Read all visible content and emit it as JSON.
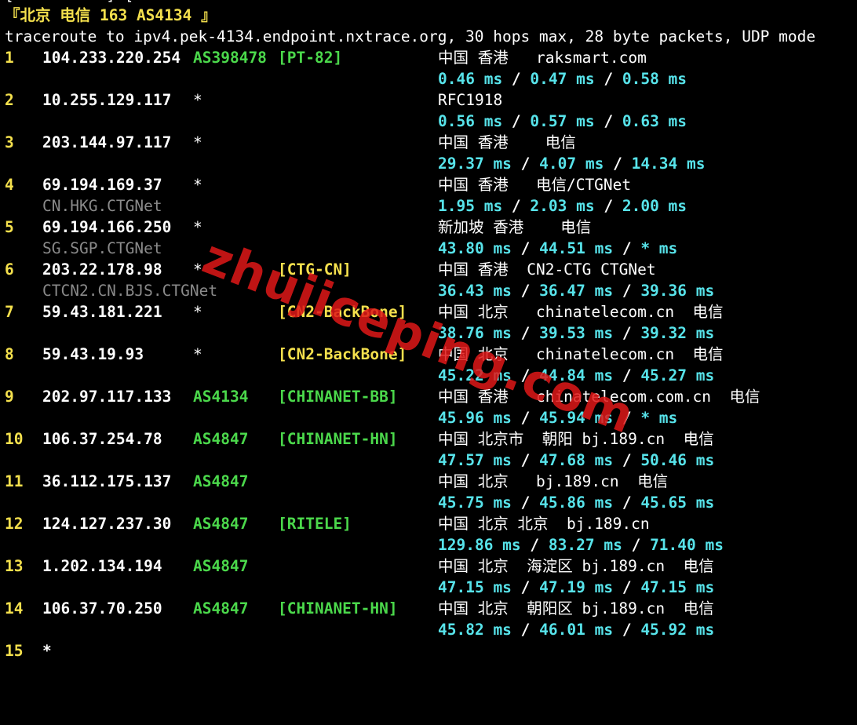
{
  "top_cut": "[          ] [",
  "header": {
    "title": "『北京 电信 163 AS4134 』",
    "command": "traceroute to ipv4.pek-4134.endpoint.nxtrace.org, 30 hops max, 28 byte packets, UDP mode"
  },
  "hops": [
    {
      "n": "1",
      "ip": "104.233.220.254",
      "asn": "AS398478",
      "tag": "[PT-82]",
      "tagColor": "green",
      "loc": "中国 香港   raksmart.com",
      "rdns": "",
      "rtt": [
        "0.46 ms",
        "0.47 ms",
        "0.58 ms"
      ]
    },
    {
      "n": "2",
      "ip": "10.255.129.117",
      "asn": "*",
      "tag": "",
      "tagColor": "",
      "loc": "RFC1918",
      "rdns": "",
      "rtt": [
        "0.56 ms",
        "0.57 ms",
        "0.63 ms"
      ]
    },
    {
      "n": "3",
      "ip": "203.144.97.117",
      "asn": "*",
      "tag": "",
      "tagColor": "",
      "loc": "中国 香港    电信",
      "rdns": "",
      "rtt": [
        "29.37 ms",
        "4.07 ms",
        "14.34 ms"
      ]
    },
    {
      "n": "4",
      "ip": "69.194.169.37",
      "asn": "*",
      "tag": "",
      "tagColor": "",
      "loc": "中国 香港   电信/CTGNet",
      "rdns": "CN.HKG.CTGNet",
      "rtt": [
        "1.95 ms",
        "2.03 ms",
        "2.00 ms"
      ]
    },
    {
      "n": "5",
      "ip": "69.194.166.250",
      "asn": "*",
      "tag": "",
      "tagColor": "",
      "loc": "新加坡 香港    电信",
      "rdns": "SG.SGP.CTGNet",
      "rtt": [
        "43.80 ms",
        "44.51 ms",
        "* ms"
      ]
    },
    {
      "n": "6",
      "ip": "203.22.178.98",
      "asn": "*",
      "tag": "[CTG-CN]",
      "tagColor": "yellow",
      "loc": "中国 香港  CN2-CTG CTGNet",
      "rdns": "CTCN2.CN.BJS.CTGNet",
      "rtt": [
        "36.43 ms",
        "36.47 ms",
        "39.36 ms"
      ]
    },
    {
      "n": "7",
      "ip": "59.43.181.221",
      "asn": "*",
      "tag": "[CN2-BackBone]",
      "tagColor": "yellow",
      "loc": "中国 北京   chinatelecom.cn  电信",
      "rdns": "",
      "rtt": [
        "38.76 ms",
        "39.53 ms",
        "39.32 ms"
      ]
    },
    {
      "n": "8",
      "ip": "59.43.19.93",
      "asn": "*",
      "tag": "[CN2-BackBone]",
      "tagColor": "yellow",
      "loc": "中国 北京   chinatelecom.cn  电信",
      "rdns": "",
      "rtt": [
        "45.22 ms",
        "44.84 ms",
        "45.27 ms"
      ]
    },
    {
      "n": "9",
      "ip": "202.97.117.133",
      "asn": "AS4134",
      "tag": "[CHINANET-BB]",
      "tagColor": "green",
      "loc": "中国 香港   chinatelecom.com.cn  电信",
      "rdns": "",
      "rtt": [
        "45.96 ms",
        "45.94 ms",
        "* ms"
      ]
    },
    {
      "n": "10",
      "ip": "106.37.254.78",
      "asn": "AS4847",
      "tag": "[CHINANET-HN]",
      "tagColor": "green",
      "loc": "中国 北京市  朝阳 bj.189.cn  电信",
      "rdns": "",
      "rtt": [
        "47.57 ms",
        "47.68 ms",
        "50.46 ms"
      ]
    },
    {
      "n": "11",
      "ip": "36.112.175.137",
      "asn": "AS4847",
      "tag": "",
      "tagColor": "",
      "loc": "中国 北京   bj.189.cn  电信",
      "rdns": "",
      "rtt": [
        "45.75 ms",
        "45.86 ms",
        "45.65 ms"
      ]
    },
    {
      "n": "12",
      "ip": "124.127.237.30",
      "asn": "AS4847",
      "tag": "[RITELE]",
      "tagColor": "green",
      "loc": "中国 北京 北京  bj.189.cn",
      "rdns": "",
      "rtt": [
        "129.86 ms",
        "83.27 ms",
        "71.40 ms"
      ]
    },
    {
      "n": "13",
      "ip": "1.202.134.194",
      "asn": "AS4847",
      "tag": "",
      "tagColor": "",
      "loc": "中国 北京  海淀区 bj.189.cn  电信",
      "rdns": "",
      "rtt": [
        "47.15 ms",
        "47.19 ms",
        "47.15 ms"
      ]
    },
    {
      "n": "14",
      "ip": "106.37.70.250",
      "asn": "AS4847",
      "tag": "[CHINANET-HN]",
      "tagColor": "green",
      "loc": "中国 北京  朝阳区 bj.189.cn  电信",
      "rdns": "",
      "rtt": [
        "45.82 ms",
        "46.01 ms",
        "45.92 ms"
      ]
    }
  ],
  "last_hop": {
    "n": "15",
    "ip": "*"
  },
  "watermark": "zhujiceping.com",
  "colors": {
    "background": "#000000",
    "hop_number": "#f4e04d",
    "ip": "#ffffff",
    "asn": "#4bd84b",
    "rtt": "#57e3ea",
    "rdns": "#8a8a8a"
  }
}
